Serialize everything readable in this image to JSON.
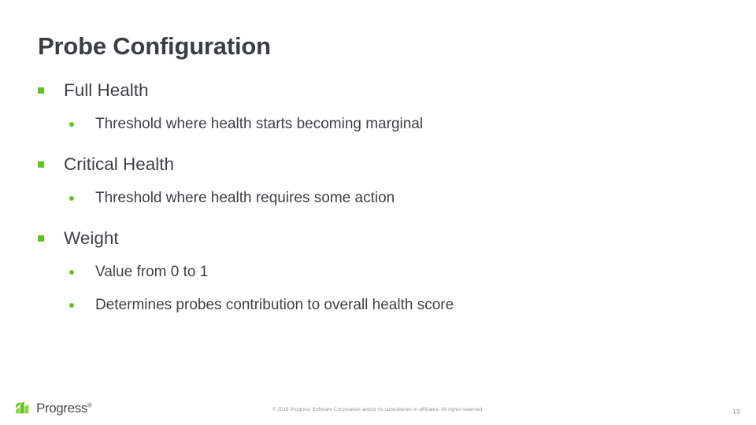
{
  "slide": {
    "title": "Probe Configuration",
    "bullets": [
      {
        "level": 1,
        "text": "Full Health",
        "marker": "green-square-bullet-icon"
      },
      {
        "level": 2,
        "text": "Threshold where health starts becoming marginal",
        "marker": "green-dot-bullet-icon"
      },
      {
        "level": 1,
        "text": "Critical Health",
        "marker": "green-square-bullet-icon"
      },
      {
        "level": 2,
        "text": "Threshold where health requires some action",
        "marker": "green-dot-bullet-icon"
      },
      {
        "level": 1,
        "text": "Weight",
        "marker": "green-square-bullet-icon"
      },
      {
        "level": 2,
        "text": "Value from 0 to 1",
        "marker": "green-dot-bullet-icon"
      },
      {
        "level": 2,
        "text": "Determines probes contribution to overall health score",
        "marker": "green-dot-bullet-icon"
      }
    ]
  },
  "footer": {
    "logo_name": "Progress",
    "logo_registered_mark": "®",
    "logo_mark_icon": "progress-arrow-logo-icon",
    "copyright": "© 2019 Progress Software Corporation and/or its subsidiaries or affiliates. All rights reserved.",
    "page_number": "19"
  },
  "colors": {
    "brand_green": "#5CC61F",
    "title_text": "#3B3E43",
    "body_text": "#3F4146",
    "footer_text": "#8E9196",
    "background": "#FFFFFF"
  }
}
